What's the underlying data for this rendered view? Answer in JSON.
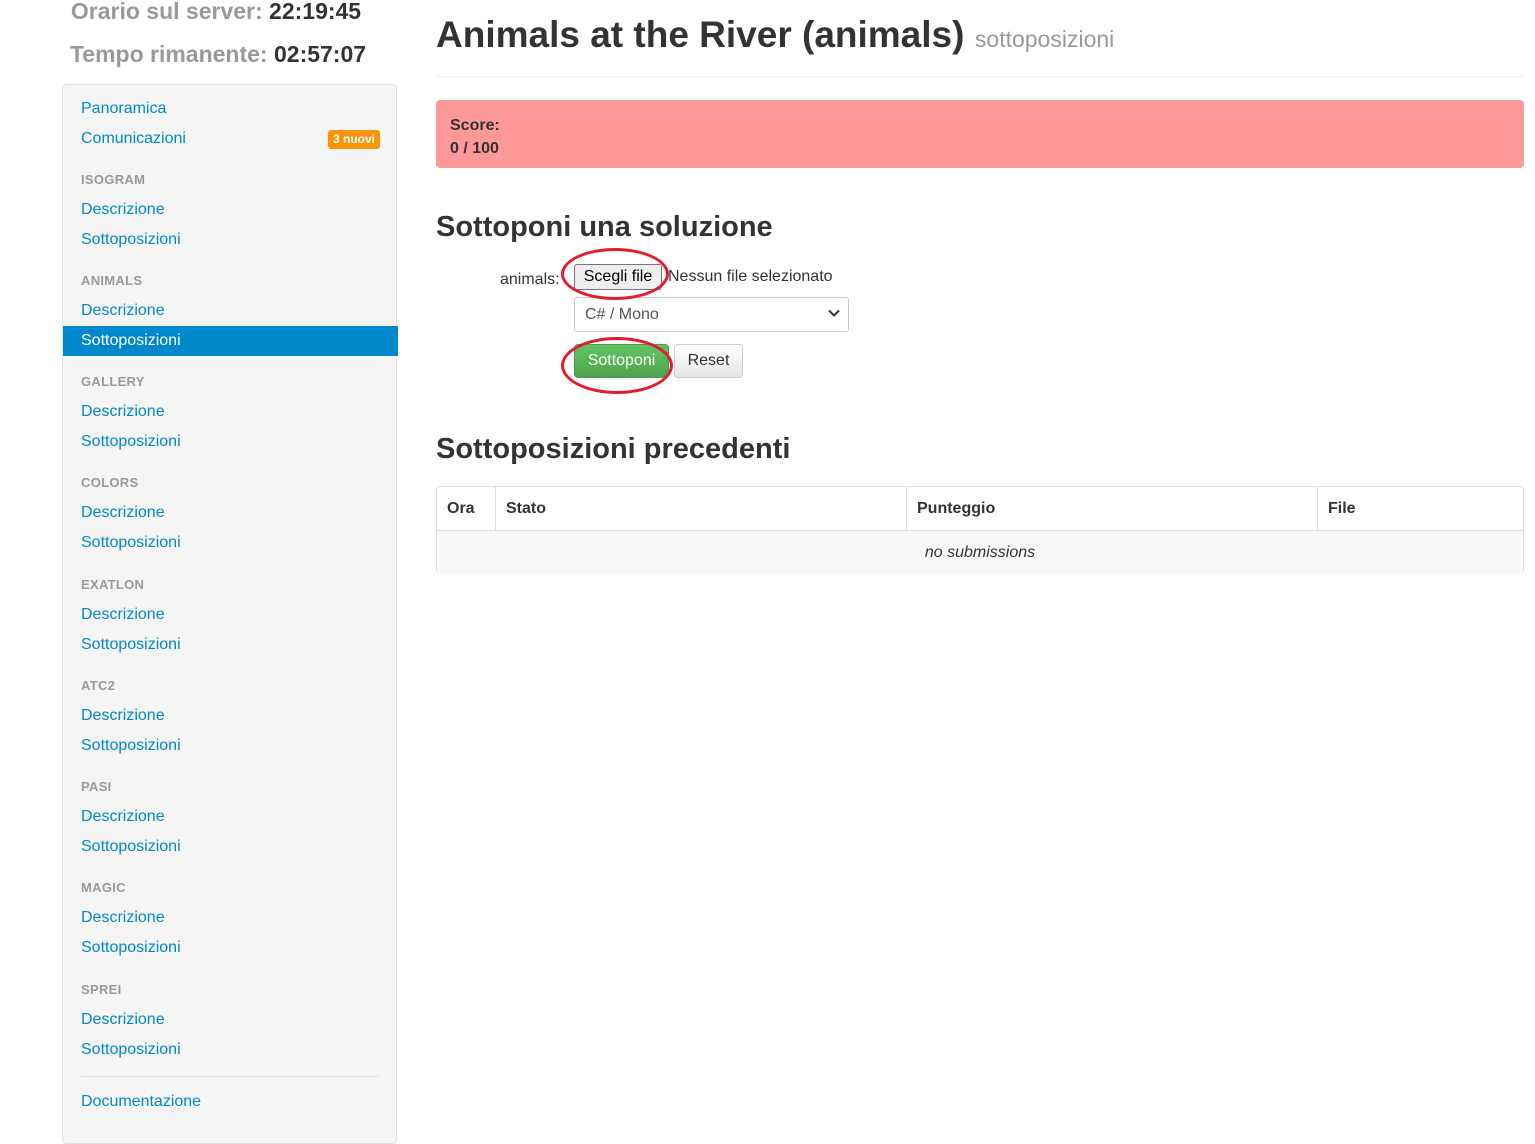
{
  "clock": {
    "server_label": "Orario sul server:",
    "server_time": "22:19:45",
    "remaining_label": "Tempo rimanente:",
    "remaining_time": "02:57:07"
  },
  "sidebar": {
    "overview": "Panoramica",
    "communications": "Comunicazioni",
    "communications_badge": "3 nuovi",
    "tasks": [
      {
        "name": "ISOGRAM",
        "description": "Descrizione",
        "submissions": "Sottoposizioni"
      },
      {
        "name": "ANIMALS",
        "description": "Descrizione",
        "submissions": "Sottoposizioni"
      },
      {
        "name": "GALLERY",
        "description": "Descrizione",
        "submissions": "Sottoposizioni"
      },
      {
        "name": "COLORS",
        "description": "Descrizione",
        "submissions": "Sottoposizioni"
      },
      {
        "name": "EXATLON",
        "description": "Descrizione",
        "submissions": "Sottoposizioni"
      },
      {
        "name": "ATC2",
        "description": "Descrizione",
        "submissions": "Sottoposizioni"
      },
      {
        "name": "PASI",
        "description": "Descrizione",
        "submissions": "Sottoposizioni"
      },
      {
        "name": "MAGIC",
        "description": "Descrizione",
        "submissions": "Sottoposizioni"
      },
      {
        "name": "SPREI",
        "description": "Descrizione",
        "submissions": "Sottoposizioni"
      }
    ],
    "documentation": "Documentazione"
  },
  "header": {
    "title": "Animals at the River (animals)",
    "subtitle": "sottoposizioni"
  },
  "score": {
    "label": "Score:",
    "value": "0 / 100"
  },
  "submit_form": {
    "title": "Sottoponi una soluzione",
    "file_label": "animals:",
    "choose_file": "Scegli file",
    "no_file": "Nessun file selezionato",
    "language_selected": "C# / Mono",
    "submit_label": "Sottoponi",
    "reset_label": "Reset"
  },
  "previous": {
    "title": "Sottoposizioni precedenti",
    "columns": [
      "Ora",
      "Stato",
      "Punteggio",
      "File"
    ],
    "empty_message": "no submissions"
  },
  "colors": {
    "link": "#0088cc",
    "active": "#0088cc",
    "badge": "#f89406",
    "score_bg": "#ff9999",
    "submit": "#5bb75b",
    "annotation": "#e01e2e"
  }
}
